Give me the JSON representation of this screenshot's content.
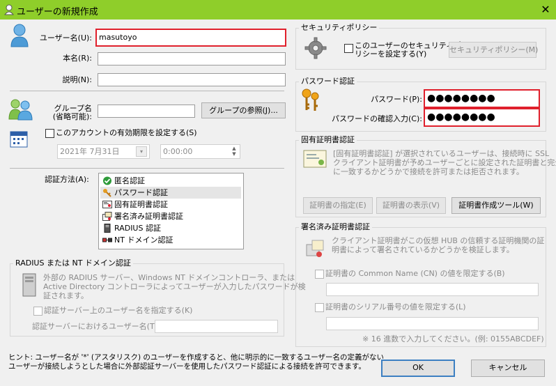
{
  "window": {
    "title": "ユーザーの新規作成",
    "close": "✕"
  },
  "user": {
    "username_label": "ユーザー名(U):",
    "username_value": "masutoyo",
    "realname_label": "本名(R):",
    "realname_value": "",
    "description_label": "説明(N):",
    "description_value": ""
  },
  "group": {
    "label_line1": "グループ名",
    "label_line2": "(省略可能):",
    "value": "",
    "browse_button": "グループの参照(J)..."
  },
  "expiry": {
    "checkbox_label": "このアカウントの有効期限を設定する(S)",
    "date_value": "2021年  7月31日",
    "time_value": "0:00:00"
  },
  "auth": {
    "label": "認証方法(A):",
    "methods": [
      "匿名認証",
      "パスワード認証",
      "固有証明書認証",
      "署名済み証明書認証",
      "RADIUS 認証",
      "NT ドメイン認証"
    ],
    "selected_index": 1
  },
  "radius": {
    "title": "RADIUS または NT ドメイン認証",
    "desc": [
      "外部の RADIUS サーバー、Windows NT ドメインコントローラ、または",
      "Active Directory コントローラによってユーザーが入力したパスワードが検",
      "証されます。"
    ],
    "checkbox_label": "認証サーバー上のユーザー名を指定する(K)",
    "server_user_label": "認証サーバーにおけるユーザー名(T):",
    "server_user_value": ""
  },
  "security_policy": {
    "title": "セキュリティポリシー",
    "checkbox_line1": "このユーザーのセキュリティポ",
    "checkbox_line2": "リシーを設定する(Y)",
    "button": "セキュリティポリシー(M)"
  },
  "password": {
    "title": "パスワード認証",
    "password_label": "パスワード(P):",
    "password_value": "●●●●●●●●",
    "confirm_label": "パスワードの確認入力(C):",
    "confirm_value": "●●●●●●●●"
  },
  "cert": {
    "title": "固有証明書認証",
    "desc": [
      "[固有証明書認証] が選択されているユーザーは、接続時に SSL",
      "クライアント証明書が予めユーザーごとに設定された証明書と完全",
      "に一致するかどうかで接続を許可または拒否されます。"
    ],
    "specify_button": "証明書の指定(E)",
    "view_button": "証明書の表示(V)",
    "tool_button": "証明書作成ツール(W)"
  },
  "signed_cert": {
    "title": "署名済み証明書認証",
    "desc": [
      "クライアント証明書がこの仮想 HUB の信頼する証明機関の証",
      "明書によって署名されているかどうかを検証します。"
    ],
    "cn_checkbox": "証明書の Common Name (CN) の値を限定する(B)",
    "cn_value": "",
    "serial_checkbox": "証明書のシリアル番号の値を限定する(L)",
    "serial_value": "",
    "hex_note": "※ 16 進数で入力してください。(例: 0155ABCDEF)"
  },
  "hint": [
    "ヒント: ユーザー名が '*' (アスタリスク) のユーザーを作成すると、他に明示的に一致するユーザー名の定義がない",
    "ユーザーが接続しようとした場合に外部認証サーバーを使用したパスワード認証による接続を許可できます。"
  ],
  "buttons": {
    "ok": "OK",
    "cancel": "キャンセル"
  },
  "colors": {
    "titlebar": "#8fce2a",
    "highlight": "#e0202c",
    "default_button_border": "#3c7fc2"
  }
}
